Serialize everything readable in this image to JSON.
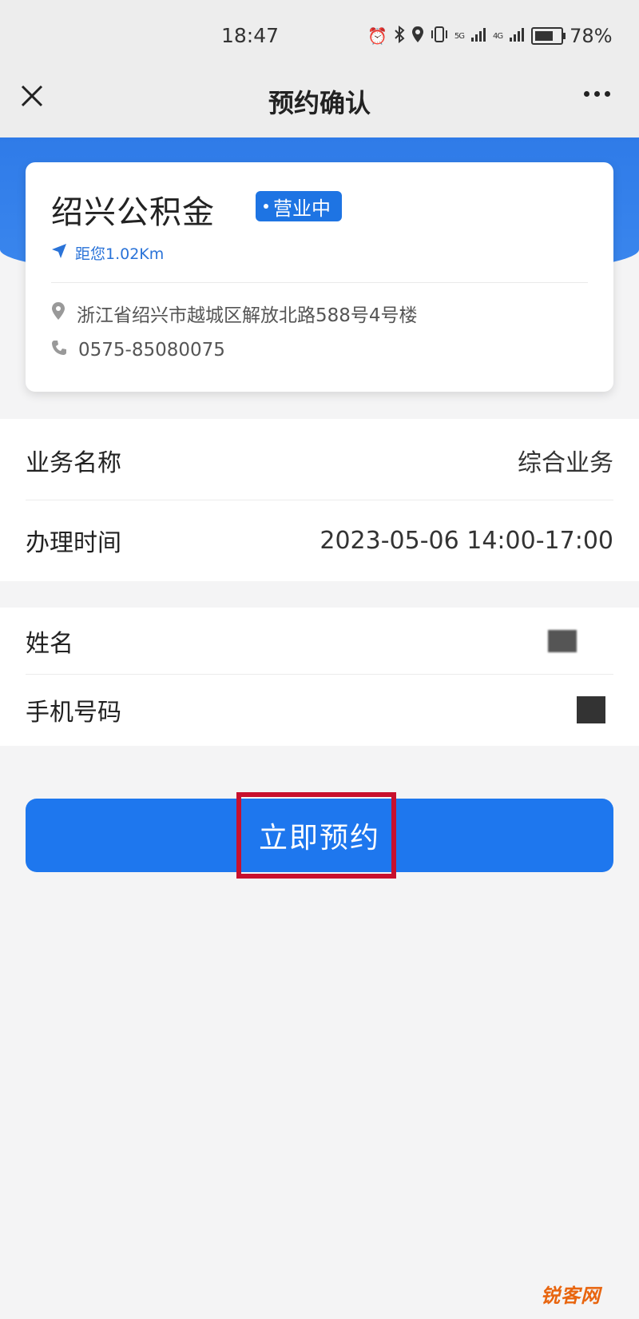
{
  "status_bar": {
    "time": "18:47",
    "network_1": "5G",
    "network_2": "4G",
    "battery_percent": "78%",
    "battery_level": 0.78,
    "icons": [
      "alarm-icon",
      "bluetooth-icon",
      "location-icon",
      "vibrate-icon",
      "signal-icon",
      "signal-icon",
      "battery-icon"
    ]
  },
  "nav": {
    "title": "预约确认",
    "close_icon": "close-icon",
    "more_icon": "more-icon"
  },
  "office": {
    "name": "绍兴公积金",
    "status": "营业中",
    "distance": "距您1.02Km",
    "address": "浙江省绍兴市越城区解放北路588号4号楼",
    "phone": "0575-85080075"
  },
  "booking": {
    "service_label": "业务名称",
    "service_value": "综合业务",
    "time_label": "办理时间",
    "time_value": "2023-05-06 14:00-17:00"
  },
  "user": {
    "name_label": "姓名",
    "phone_label": "手机号码"
  },
  "action": {
    "book_label": "立即预约"
  },
  "watermark": "锐客网",
  "colors": {
    "primary": "#1e77ee",
    "badge": "#1e74e3",
    "highlight": "#c8102e",
    "distance_text": "#2a73d8",
    "watermark": "#e8650f"
  }
}
